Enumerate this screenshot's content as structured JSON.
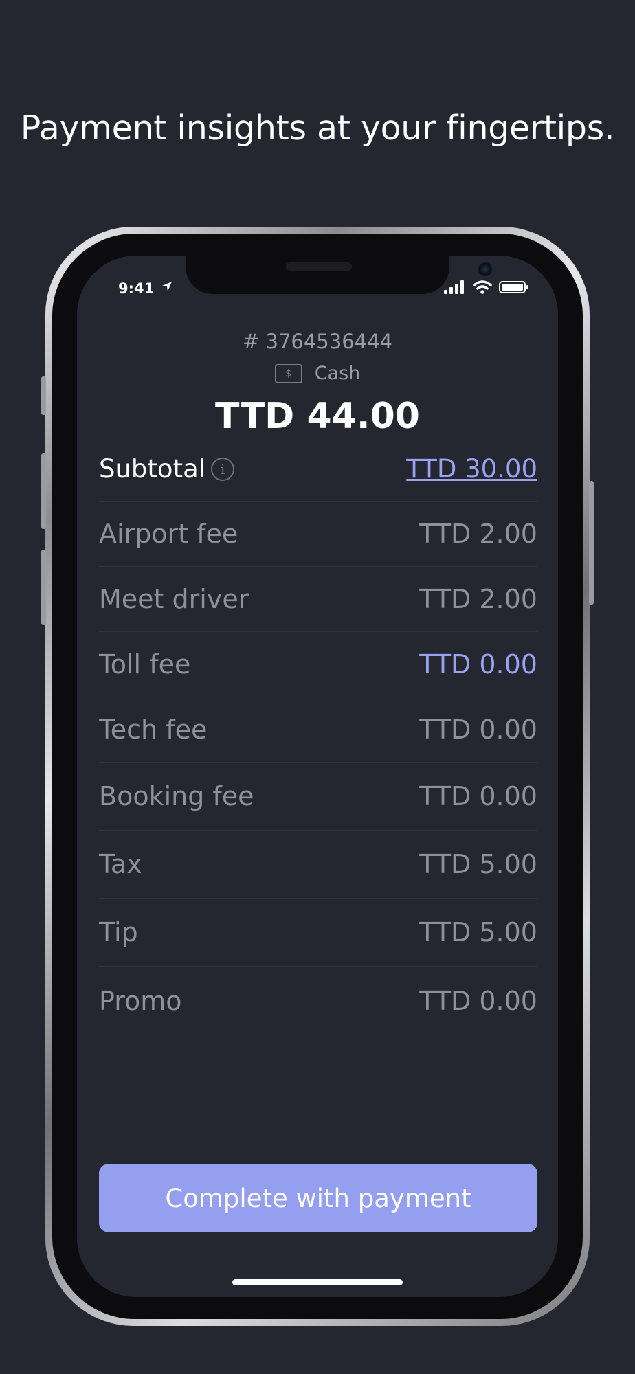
{
  "headline": "Payment insights at your fingertips.",
  "status_bar": {
    "time": "9:41",
    "icons": [
      "location-arrow-icon",
      "signal-icon",
      "wifi-icon",
      "battery-icon"
    ]
  },
  "order": {
    "number": "# 3764536444",
    "method_icon_text": "$",
    "method": "Cash",
    "total": "TTD 44.00"
  },
  "subtotal": {
    "label": "Subtotal",
    "value": "TTD 30.00"
  },
  "fees": [
    {
      "label": "Airport fee",
      "value": "TTD 2.00"
    },
    {
      "label": "Meet driver",
      "value": "TTD 2.00"
    },
    {
      "label": "Toll fee",
      "value": "TTD 0.00"
    },
    {
      "label": "Tech fee",
      "value": "TTD 0.00"
    },
    {
      "label": "Booking fee",
      "value": "TTD 0.00"
    },
    {
      "label": "Tax",
      "value": "TTD 5.00"
    },
    {
      "label": "Tip",
      "value": "TTD 5.00"
    },
    {
      "label": "Promo",
      "value": "TTD 0.00"
    }
  ],
  "actions": {
    "complete_label": "Complete with payment"
  },
  "colors": {
    "background": "#252730",
    "screen": "#242630",
    "accent": "#959ff0",
    "link": "#9aa2f0",
    "muted_text": "#8f9099"
  }
}
